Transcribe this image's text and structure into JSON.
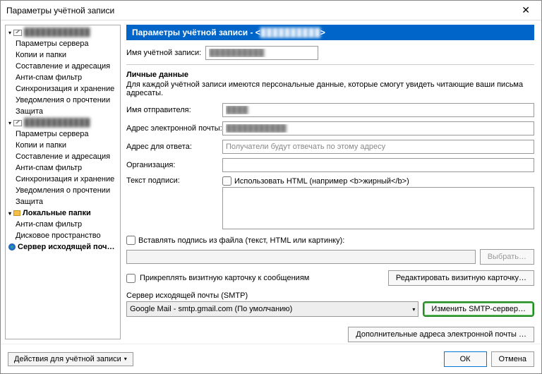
{
  "window": {
    "title": "Параметры учётной записи"
  },
  "sidebar": {
    "account1": {
      "label": "████████████"
    },
    "account2": {
      "label": "████████████"
    },
    "items": [
      "Параметры сервера",
      "Копии и папки",
      "Составление и адресация",
      "Анти-спам фильтр",
      "Синхронизация и хранение",
      "Уведомления о прочтении",
      "Защита"
    ],
    "localFolders": "Локальные папки",
    "localItems": [
      "Анти-спам фильтр",
      "Дисковое пространство"
    ],
    "outgoing": "Сервер исходящей поч…"
  },
  "actionsButton": "Действия для учётной записи",
  "header": {
    "prefix": "Параметры учётной записи - <",
    "account": "██████████",
    "suffix": ">"
  },
  "accountName": {
    "label": "Имя учётной записи:",
    "value": "██████████"
  },
  "personal": {
    "title": "Личные данные",
    "desc": "Для каждой учётной записи имеются персональные данные, которые смогут увидеть читающие ваши письма адресаты.",
    "senderName": {
      "label": "Имя отправителя:",
      "value": "████"
    },
    "email": {
      "label": "Адрес электронной почты:",
      "value": "███████████"
    },
    "replyTo": {
      "label": "Адрес для ответа:",
      "placeholder": "Получатели будут отвечать по этому адресу"
    },
    "org": {
      "label": "Организация:",
      "value": ""
    },
    "signature": {
      "label": "Текст подписи:",
      "htmlCheckbox": "Использовать HTML (например <b>жирный</b>)"
    }
  },
  "insertFile": {
    "checkbox": "Вставлять подпись из файла (текст, HTML или картинку):",
    "browse": "Выбрать…"
  },
  "attachCard": {
    "checkbox": "Прикреплять визитную карточку к сообщениям",
    "edit": "Редактировать визитную карточку…"
  },
  "smtp": {
    "label": "Сервер исходящей почты (SMTP)",
    "selected": "Google Mail - smtp.gmail.com (По умолчанию)",
    "edit": "Изменить SMTP-сервер…"
  },
  "extraAddresses": "Дополнительные адреса электронной почты …",
  "footer": {
    "ok": "ОК",
    "cancel": "Отмена"
  }
}
